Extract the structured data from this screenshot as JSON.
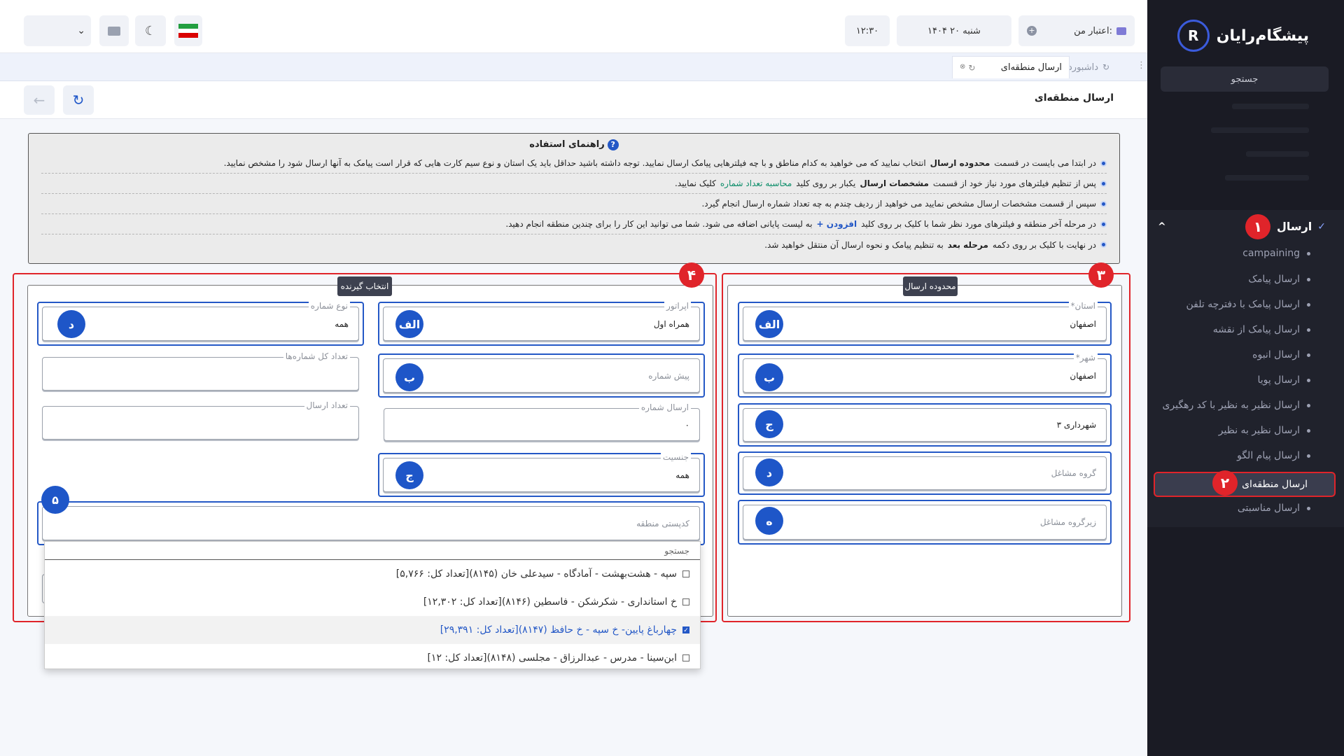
{
  "sidebar": {
    "logo_text": "پیشگام‌رایان",
    "search_label": "جستجو",
    "menu_title": "ارسال",
    "badge_1": "۱",
    "badge_2": "۲",
    "items": [
      "campaining",
      "ارسال پیامک",
      "ارسال پیامک با دفترچه تلفن",
      "ارسال پیامک از نقشه",
      "ارسال انبوه",
      "ارسال پویا",
      "ارسال نظیر به نظیر با کد رهگیری",
      "ارسال نظیر به نظیر",
      "ارسال پیام الگو"
    ],
    "active_item": "ارسال منطقه‌ای",
    "after_item": "ارسال مناسبتی"
  },
  "topbar": {
    "credit_label": "اعتبار من:",
    "date": "شنبه ۲۰ ۱۴۰۴",
    "time": "۱۲:۳۰"
  },
  "tabs": {
    "dashboard": "داشبورد",
    "active": "ارسال منطقه‌ای"
  },
  "page_title": "ارسال منطقه‌ای",
  "guide": {
    "title": "راهنمای استفاده",
    "r1_a": "در ابتدا می بایست در قسمت",
    "r1_b": "محدوده ارسال",
    "r1_c": "انتخاب نمایید که می خواهید به کدام مناطق و با چه فیلترهایی پیامک ارسال نمایید. توجه داشته باشید حداقل باید یک استان و نوع سیم کارت هایی که قرار است پیامک به آنها ارسال شود را مشخص نمایید.",
    "r2_a": "پس از تنظیم فیلترهای مورد نیاز خود از قسمت",
    "r2_b": "مشخصات ارسال",
    "r2_c": "یکبار بر روی کلید",
    "r2_d": "محاسبه تعداد شماره",
    "r2_e": "کلیک نمایید.",
    "r3": "سپس از قسمت مشخصات ارسال مشخص نمایید می خواهید از ردیف چندم به چه تعداد شماره ارسال انجام گیرد.",
    "r4_a": "در مرحله آخر منطقه و فیلترهای مورد نظر شما با کلیک بر روی کلید",
    "r4_b": "افزودن +",
    "r4_c": "به لیست پایانی اضافه می شود. شما می توانید این کار را برای چندین منطقه انجام دهید.",
    "r5_a": "در نهایت با کلیک بر روی دکمه",
    "r5_b": "مرحله بعد",
    "r5_c": "به تنظیم پیامک و نحوه ارسال آن منتقل خواهید شد."
  },
  "range_panel": {
    "title": "محدوده ارسال",
    "badge": "۳",
    "province_label": "استان*",
    "province_value": "اصفهان",
    "city_label": "شهر*",
    "city_value": "اصفهان",
    "municipality_value": "شهرداری ۳",
    "job_group_ph": "گروه مشاغل",
    "job_subgroup_ph": "زیرگروه مشاغل"
  },
  "recipient_panel": {
    "title": "انتخاب گیرنده",
    "badge": "۴",
    "operator_label": "اپراتور",
    "operator_value": "همراه اول",
    "prefix_ph": "پیش شماره",
    "send_number_label": "ارسال شماره",
    "send_number_value": "۰",
    "gender_label": "جنسیت",
    "gender_value": "همه",
    "number_type_label": "نوع شماره",
    "number_type_value": "همه",
    "total_label": "تعداد کل شماره‌ها",
    "send_count_label": "تعداد ارسال",
    "postal_ph": "کدپستی منطقه",
    "badge_5": "۵"
  },
  "circle_letters": {
    "alef": "الف",
    "be": "ب",
    "jim": "ج",
    "dal": "د",
    "he": "ه"
  },
  "dropdown": {
    "search_label": "جستجو",
    "items": [
      "سپه - هشت‌بهشت - آمادگاه - سیدعلی خان (۸۱۴۵)[تعداد کل: ۵,۷۶۶]",
      "خ استانداری - شکرشکن - فاسطین (۸۱۴۶)[تعداد کل: ۱۲,۳۰۲]",
      "چهارباغ پایین- خ سپه - خ حافظ (۸۱۴۷)[تعداد کل: ۲۹,۳۹۱]",
      "ابن‌سینا - مدرس - عبدالرزاق - مجلسی (۸۱۴۸)[تعداد کل: ۱۲]"
    ]
  },
  "colors": {
    "accent": "#1e56c8",
    "highlight": "#e0242a",
    "sidebar_bg": "#1a1b24"
  }
}
